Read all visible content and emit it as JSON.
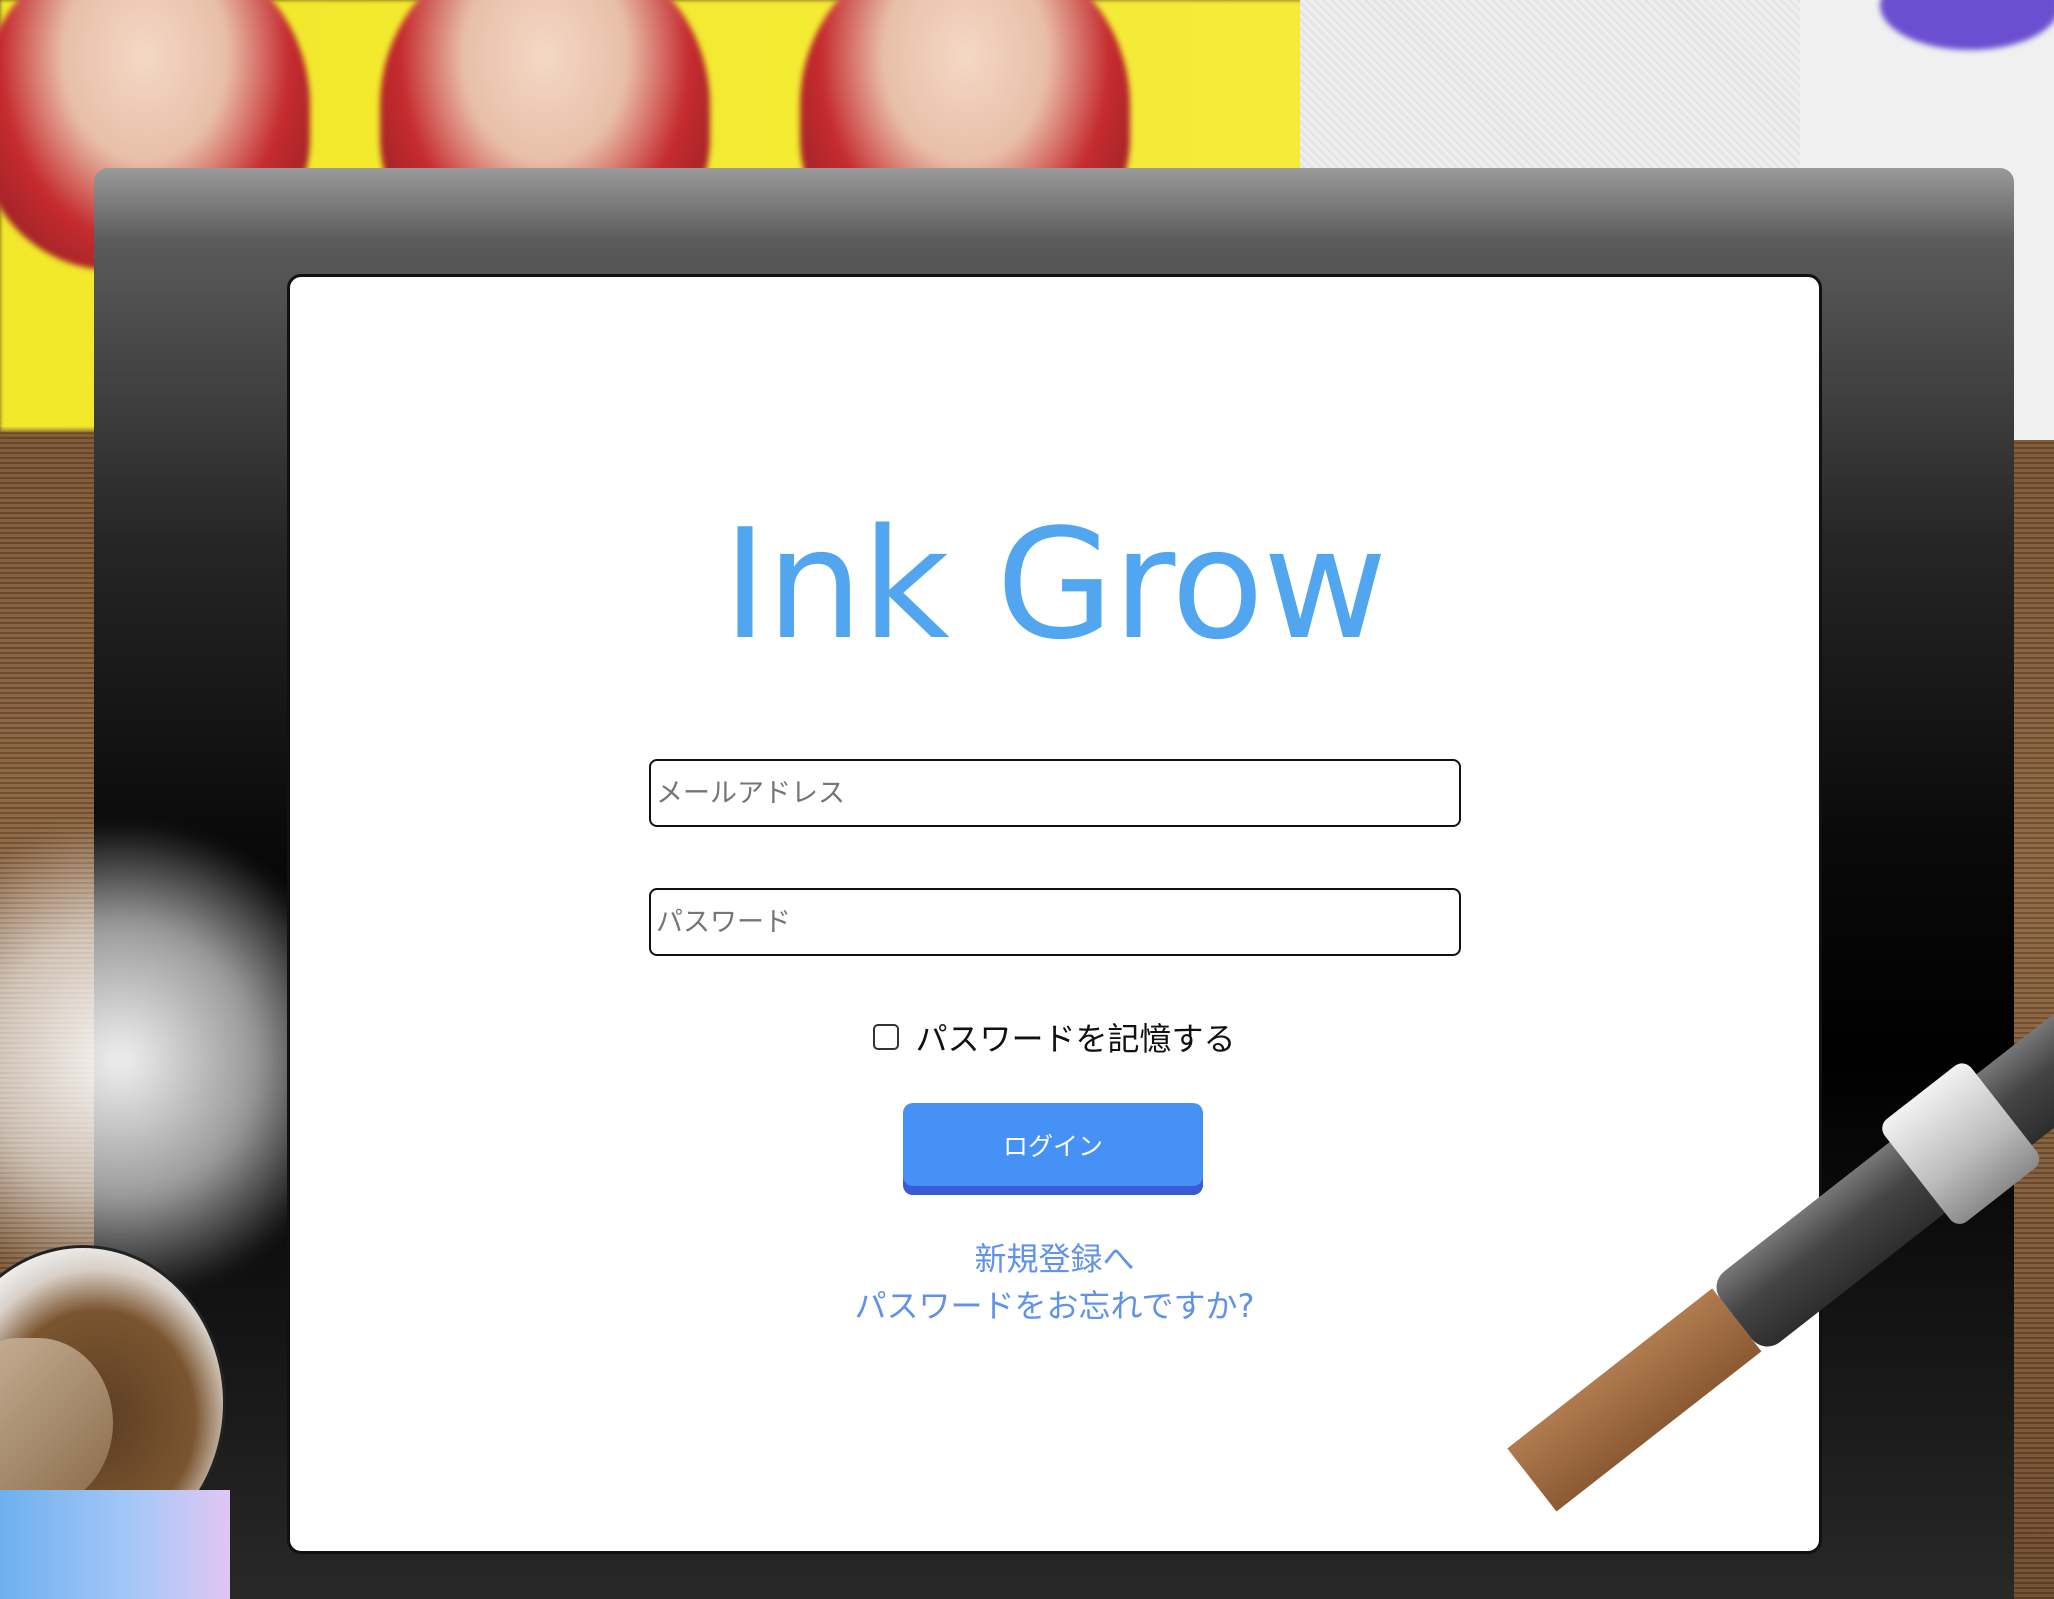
{
  "app": {
    "logo_text": "Ink Grow"
  },
  "login_form": {
    "email_placeholder": "メールアドレス",
    "email_value": "",
    "password_placeholder": "パスワード",
    "password_value": "",
    "remember_label": "パスワードを記憶する",
    "remember_checked": false,
    "login_button_label": "ログイン",
    "signup_link": "新規登録へ",
    "forgot_password_link": "パスワードをお忘れですか?"
  },
  "colors": {
    "logo": "#52a6ef",
    "button": "#4591f6",
    "button_shadow": "#3b5ad6",
    "link": "#5f92e8"
  }
}
